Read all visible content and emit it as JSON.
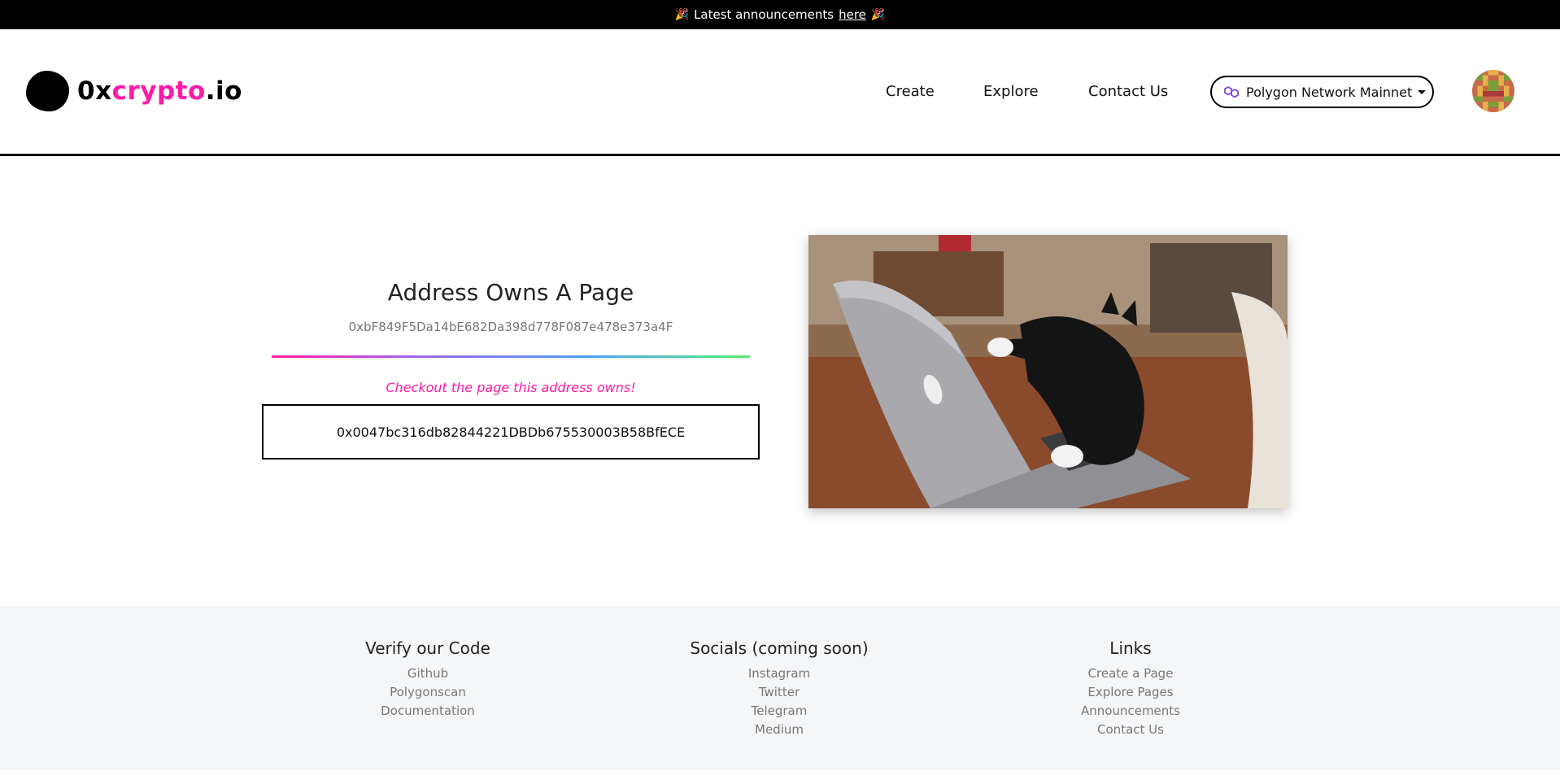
{
  "announcement": {
    "prefix": "Latest announcements",
    "link_label": "here",
    "emoji": "🎉"
  },
  "brand": {
    "prefix": "0x",
    "highlight": "crypto",
    "suffix": ".io",
    "accent_color": "#ff1aa8"
  },
  "nav": {
    "links": [
      "Create",
      "Explore",
      "Contact Us"
    ],
    "network_label": "Polygon Network Mainnet",
    "network_icon": "polygon-icon",
    "network_icon_color": "#8247e5"
  },
  "main": {
    "title": "Address Owns A Page",
    "address": "0xbF849F5Da14bE682Da398d778F087e478e373a4F",
    "checkout_text": "Checkout the page this address owns!",
    "owned_page_address": "0x0047bc316db82844221DBDb675530003B58BfECE",
    "image": "cat-typing-on-laptop-gif"
  },
  "footer": {
    "columns": [
      {
        "heading": "Verify our Code",
        "links": [
          "Github",
          "Polygonscan",
          "Documentation"
        ]
      },
      {
        "heading": "Socials (coming soon)",
        "links": [
          "Instagram",
          "Twitter",
          "Telegram",
          "Medium"
        ]
      },
      {
        "heading": "Links",
        "links": [
          "Create a Page",
          "Explore Pages",
          "Announcements",
          "Contact Us"
        ]
      }
    ]
  }
}
